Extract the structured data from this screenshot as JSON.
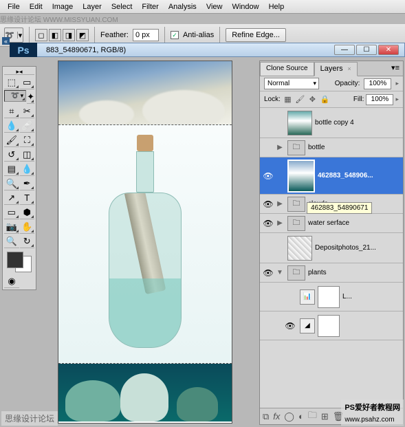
{
  "menu": {
    "file": "File",
    "edit": "Edit",
    "image": "Image",
    "layer": "Layer",
    "select": "Select",
    "filter": "Filter",
    "analysis": "Analysis",
    "view": "View",
    "window": "Window",
    "help": "Help"
  },
  "opt": {
    "feather_lbl": "Feather:",
    "feather_val": "0 px",
    "aa": "Anti-alias",
    "refine": "Refine Edge..."
  },
  "doc": {
    "title": "883_54890671, RGB/8)",
    "ps": "Ps"
  },
  "panel": {
    "tab_clone": "Clone Source",
    "tab_layers": "Layers",
    "x": "×",
    "blend": "Normal",
    "opacity_lbl": "Opacity:",
    "opacity": "100%",
    "lock_lbl": "Lock:",
    "fill_lbl": "Fill:",
    "fill": "100%",
    "layers": [
      {
        "name": "bottle copy 4"
      },
      {
        "name": "bottle"
      },
      {
        "name": "462883_548906..."
      },
      {
        "name": "clouds"
      },
      {
        "name": "water serface"
      },
      {
        "name": "Depositphotos_21..."
      },
      {
        "name": "plants"
      },
      {
        "name": "L..."
      }
    ],
    "tooltip": "462883_54890671"
  },
  "icons": {
    "eye": "👁",
    "gear": "⚙",
    "folder": "🗀",
    "lasso": "➰",
    "levels": "📊",
    "triangle": "▶",
    "triangle_d": "▼",
    "minus": "—",
    "square": "☐",
    "close": "✕",
    "plus": "✚",
    "move": "✥",
    "lock": "🔒",
    "trans": "▦",
    "chain": "⧉",
    "fx": "fx",
    "mask": "◯",
    "adj": "◐",
    "newl": "⊞",
    "trash": "🗑"
  },
  "wm": {
    "a": "思缘设计论坛",
    "b": "PS爱好者教程网",
    "c": "思缘设计论坛 WWW.MISSYUAN.COM",
    "d": "www.psahz.com"
  }
}
